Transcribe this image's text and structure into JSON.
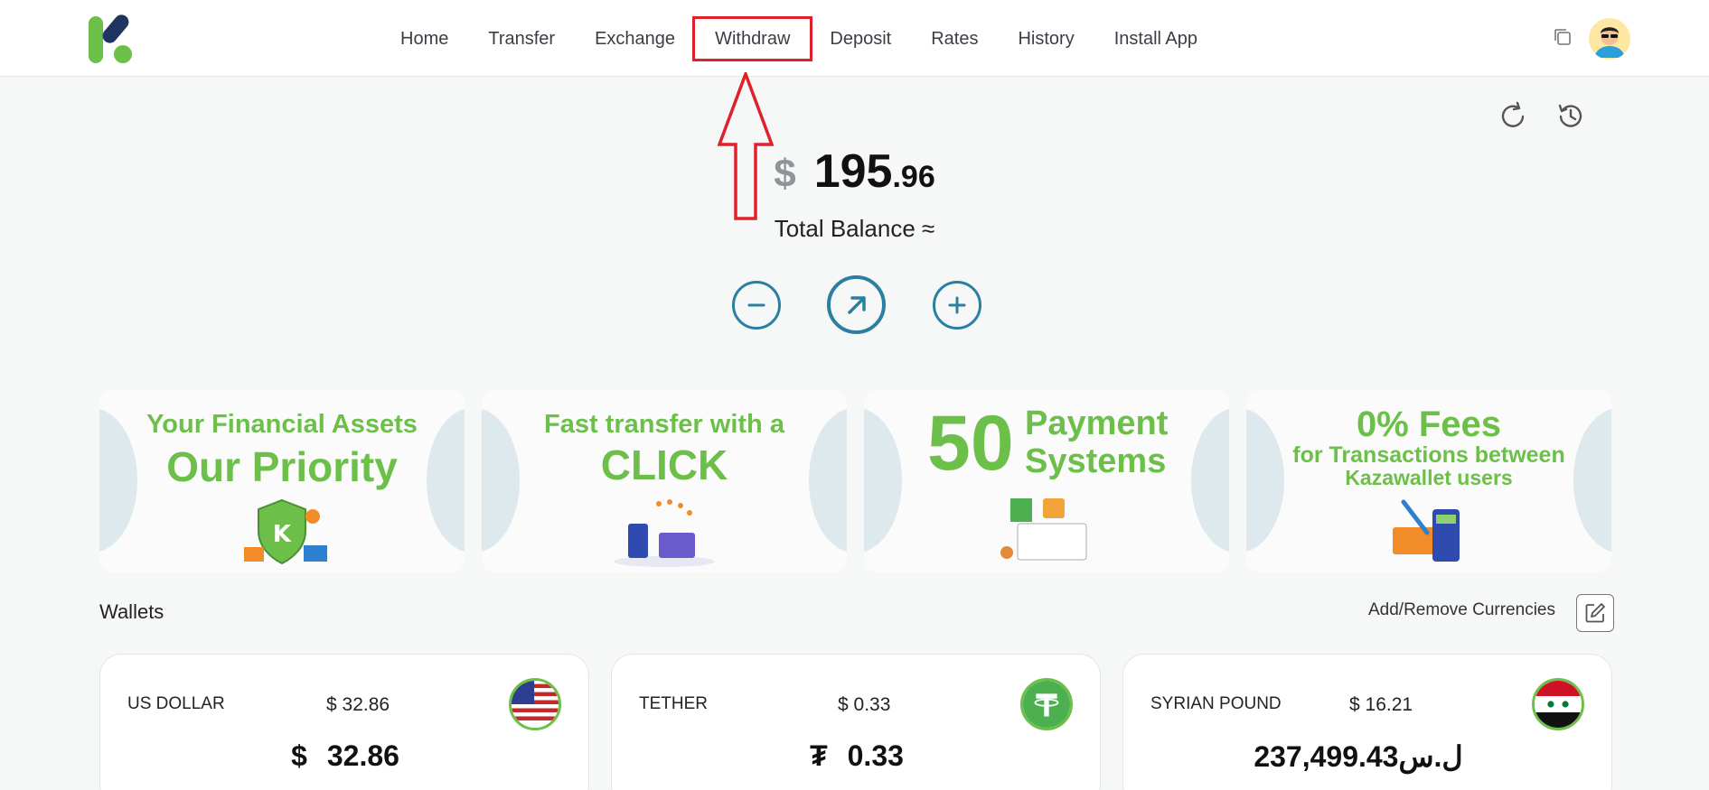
{
  "nav": {
    "items": [
      "Home",
      "Transfer",
      "Exchange",
      "Withdraw",
      "Deposit",
      "Rates",
      "History",
      "Install App"
    ],
    "highlighted": "Withdraw"
  },
  "balance": {
    "currency_symbol": "$",
    "integer": "195",
    "decimal": ".96",
    "label": "Total Balance ≈"
  },
  "banners": [
    {
      "line1": "Your Financial Assets",
      "line2": "Our Priority"
    },
    {
      "line1": "Fast transfer with a",
      "line2": "CLICK"
    },
    {
      "number": "50",
      "line1": "Payment",
      "line2": "Systems"
    },
    {
      "line1": "0% Fees",
      "line2": "for Transactions between",
      "line3": "Kazawallet users"
    }
  ],
  "wallets": {
    "title": "Wallets",
    "add_remove_label": "Add/Remove Currencies",
    "cards": [
      {
        "name": "US DOLLAR",
        "usd_value": "$ 32.86",
        "symbol": "$",
        "amount": "32.86",
        "flag": "us-flag-icon"
      },
      {
        "name": "TETHER",
        "usd_value": "$ 0.33",
        "symbol": "₮",
        "amount": "0.33",
        "flag": "tether-icon"
      },
      {
        "name": "SYRIAN POUND",
        "usd_value": "$ 16.21",
        "symbol": "ل.س",
        "amount": "237,499.43",
        "flag": "syria-flag-icon"
      }
    ]
  },
  "colors": {
    "brand_green": "#6cc04a",
    "brand_navy": "#1f3561",
    "action_blue": "#2b7fa0",
    "highlight_red": "#e0202a"
  }
}
